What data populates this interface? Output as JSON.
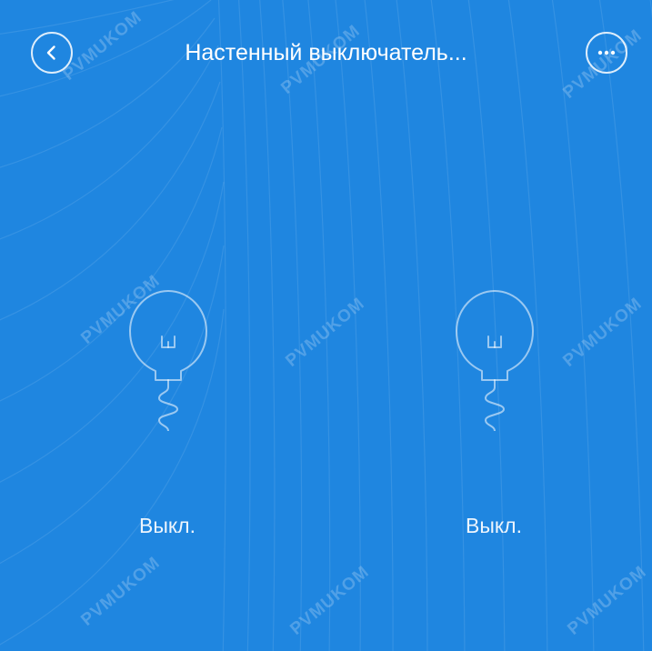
{
  "header": {
    "title": "Настенный выключатель...",
    "back_icon": "chevron-left-icon",
    "more_icon": "more-horizontal-icon"
  },
  "switches": [
    {
      "icon": "light-bulb-icon",
      "state_label": "Выкл."
    },
    {
      "icon": "light-bulb-icon",
      "state_label": "Выкл."
    }
  ],
  "watermark_text": "PVMUKOM",
  "colors": {
    "background": "#1f86e0",
    "foreground": "#ffffff"
  }
}
